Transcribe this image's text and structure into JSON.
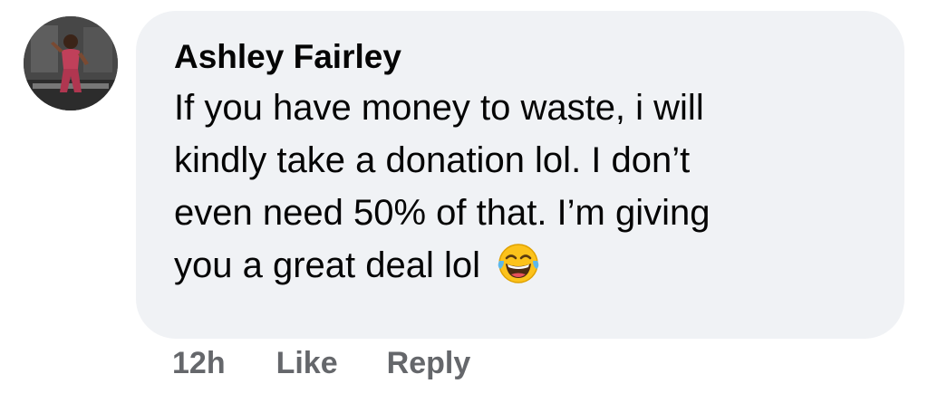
{
  "comment": {
    "author": "Ashley Fairley",
    "lines": [
      "If you have money to waste, i will",
      "kindly take a donation lol. I don’t",
      "even need 50% of that. I’m giving",
      "you a great deal lol"
    ],
    "emoji_icon": "face-with-tears-of-joy-icon",
    "avatar_icon": "profile-photo-avatar"
  },
  "actions": {
    "time": "12h",
    "like_label": "Like",
    "reply_label": "Reply"
  },
  "colors": {
    "bubble_background": "#f0f2f5",
    "text": "#050505",
    "secondary_text": "#65676b"
  }
}
